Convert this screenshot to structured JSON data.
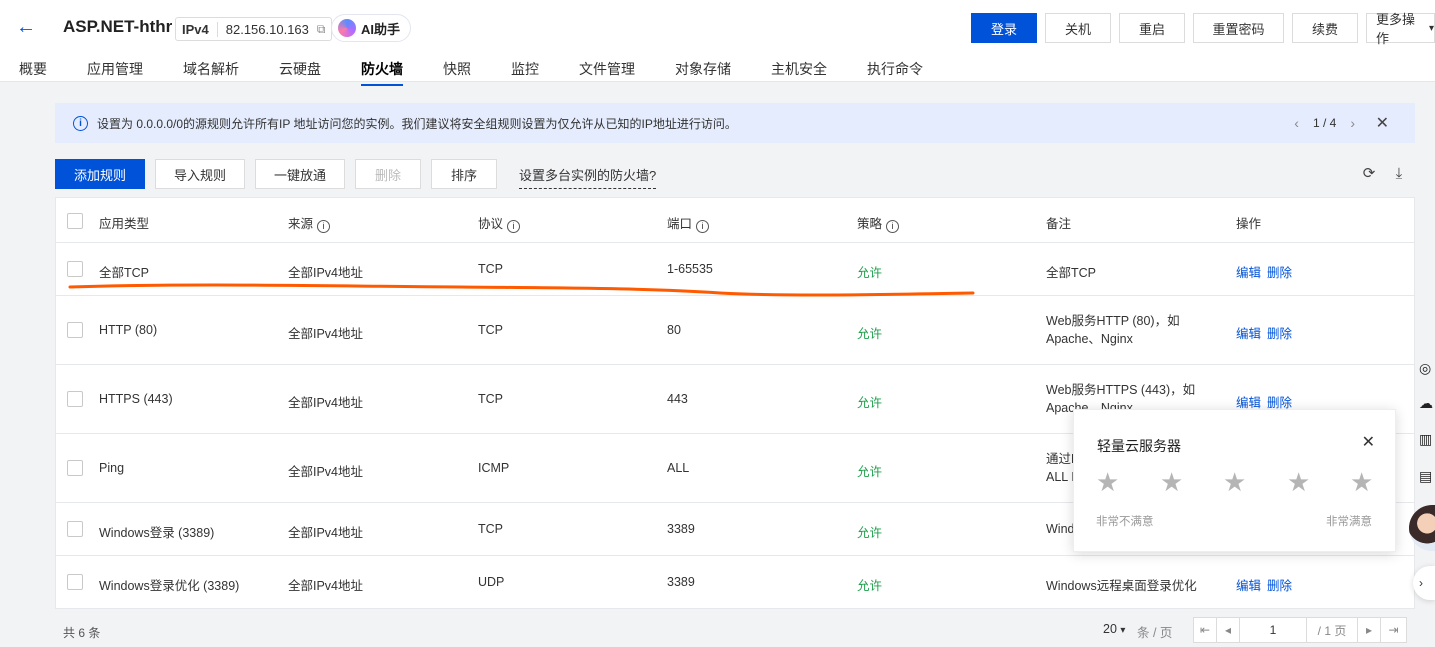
{
  "header": {
    "back_icon": "arrow-left-icon",
    "title": "ASP.NET-hthr",
    "ip_type": "IPv4",
    "ip": "82.156.10.163",
    "ai_label": "AI助手",
    "buttons": {
      "login": "登录",
      "shutdown": "关机",
      "restart": "重启",
      "reset_password": "重置密码",
      "renew": "续费",
      "more": "更多操作"
    },
    "tabs": [
      "概要",
      "应用管理",
      "域名解析",
      "云硬盘",
      "防火墙",
      "快照",
      "监控",
      "文件管理",
      "对象存储",
      "主机安全",
      "执行命令"
    ],
    "active_tab": "防火墙"
  },
  "notice": {
    "text": "设置为 0.0.0.0/0的源规则允许所有IP 地址访问您的实例。我们建议将安全组规则设置为仅允许从已知的IP地址进行访问。",
    "pager": "1 / 4"
  },
  "toolbar": {
    "add_rule": "添加规则",
    "import_rule": "导入规则",
    "one_click": "一键放通",
    "delete": "删除",
    "sort": "排序",
    "multi_link": "设置多台实例的防火墙?"
  },
  "table": {
    "headers": {
      "type": "应用类型",
      "source": "来源",
      "protocol": "协议",
      "port": "端口",
      "policy": "策略",
      "note": "备注",
      "ops": "操作"
    },
    "edit_label": "编辑",
    "delete_label": "删除",
    "rows": [
      {
        "type": "全部TCP",
        "source": "全部IPv4地址",
        "protocol": "TCP",
        "port": "1-65535",
        "policy": "允许",
        "note": "全部TCP",
        "note2": ""
      },
      {
        "type": "HTTP (80)",
        "source": "全部IPv4地址",
        "protocol": "TCP",
        "port": "80",
        "policy": "允许",
        "note": "Web服务HTTP (80)，如",
        "note2": "Apache、Nginx"
      },
      {
        "type": "HTTPS (443)",
        "source": "全部IPv4地址",
        "protocol": "TCP",
        "port": "443",
        "policy": "允许",
        "note": "Web服务HTTPS (443)，如",
        "note2": "Apache、Nginx"
      },
      {
        "type": "Ping",
        "source": "全部IPv4地址",
        "protocol": "ICMP",
        "port": "ALL",
        "policy": "允许",
        "note": "通过P",
        "note2": "ALL I"
      },
      {
        "type": "Windows登录 (3389)",
        "source": "全部IPv4地址",
        "protocol": "TCP",
        "port": "3389",
        "policy": "允许",
        "note": "Wind",
        "note2": ""
      },
      {
        "type": "Windows登录优化 (3389)",
        "source": "全部IPv4地址",
        "protocol": "UDP",
        "port": "3389",
        "policy": "允许",
        "note": "Windows远程桌面登录优化",
        "note2": ""
      }
    ]
  },
  "footer": {
    "total": "共 6 条",
    "page_size": "20",
    "page_unit": "条 / 页",
    "current_page": "1",
    "total_pages": "/ 1 页"
  },
  "rating": {
    "title": "轻量云服务器",
    "stars": 5,
    "low_label": "非常不满意",
    "high_label": "非常满意"
  },
  "colors": {
    "primary": "#0052d9",
    "allow": "#1fa04d",
    "annotation": "#ff5a00"
  }
}
